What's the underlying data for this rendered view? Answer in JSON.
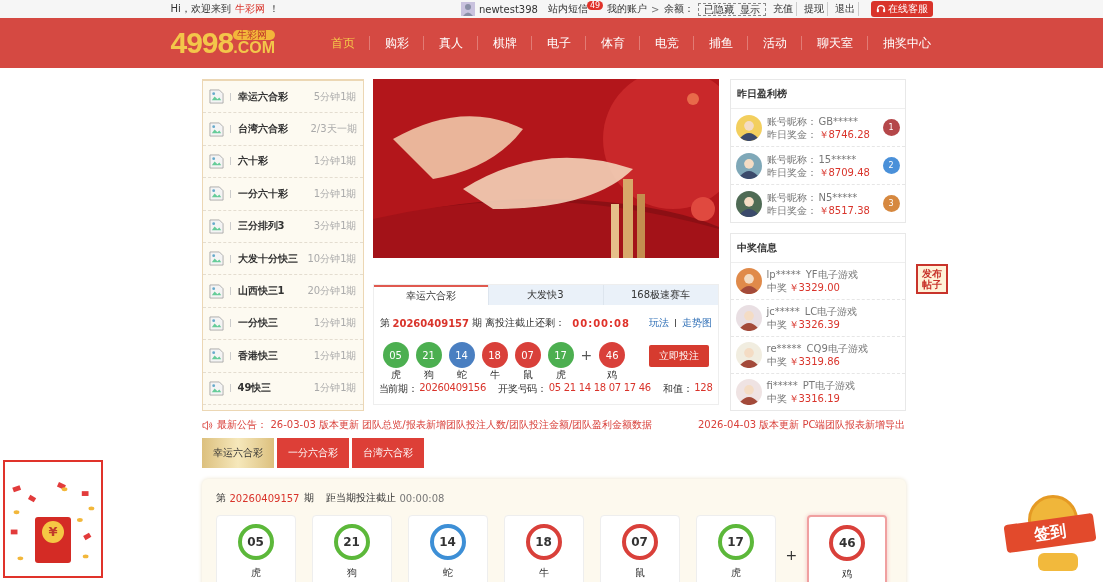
{
  "topbar": {
    "greeting": "Hi，欢迎来到",
    "site": "牛彩网",
    "exclaim": "！",
    "username": "newtest398",
    "messages": "站内短信",
    "message_count": "49",
    "account": "我的账户",
    "account_arrow": ">",
    "balance_label": "余额：",
    "balance_hidden": "已隐藏",
    "balance_show": "显示",
    "links": [
      "充值",
      "提现",
      "退出"
    ],
    "service": "在线客服"
  },
  "logo": {
    "number": "4998",
    "domain": ".COM",
    "badge": "牛彩网"
  },
  "nav": [
    {
      "label": "首页",
      "selected": true
    },
    {
      "label": "购彩",
      "selected": false
    },
    {
      "label": "真人",
      "selected": false
    },
    {
      "label": "棋牌",
      "selected": false
    },
    {
      "label": "电子",
      "selected": false
    },
    {
      "label": "体育",
      "selected": false
    },
    {
      "label": "电竞",
      "selected": false
    },
    {
      "label": "捕鱼",
      "selected": false
    },
    {
      "label": "活动",
      "selected": false
    },
    {
      "label": "聊天室",
      "selected": false
    },
    {
      "label": "抽奖中心",
      "selected": false
    }
  ],
  "lottery_list": [
    {
      "name": "幸运六合彩",
      "period": "5分钟1期"
    },
    {
      "name": "台湾六合彩",
      "period": "2/3天一期"
    },
    {
      "name": "六十彩",
      "period": "1分钟1期"
    },
    {
      "name": "一分六十彩",
      "period": "1分钟1期"
    },
    {
      "name": "三分排列3",
      "period": "3分钟1期"
    },
    {
      "name": "大发十分快三",
      "period": "10分钟1期"
    },
    {
      "name": "山西快三1",
      "period": "20分钟1期"
    },
    {
      "name": "一分快三",
      "period": "1分钟1期"
    },
    {
      "name": "香港快三",
      "period": "1分钟1期"
    },
    {
      "name": "49快三",
      "period": "1分钟1期"
    }
  ],
  "draw_panel": {
    "tabs": [
      {
        "label": "幸运六合彩",
        "selected": true
      },
      {
        "label": "大发快3",
        "selected": false
      },
      {
        "label": "168极速赛车",
        "selected": false
      }
    ],
    "issue_prefix": "第",
    "issue": "20260409157",
    "issue_suffix": "期 离投注截止还剩：",
    "countdown": "00:00:08",
    "links": [
      "玩法",
      "走势图"
    ],
    "balls": [
      {
        "number": "05",
        "zodiac": "虎",
        "color": "#4caf50"
      },
      {
        "number": "21",
        "zodiac": "狗",
        "color": "#4caf50"
      },
      {
        "number": "14",
        "zodiac": "蛇",
        "color": "#4a7fc1"
      },
      {
        "number": "18",
        "zodiac": "牛",
        "color": "#d9403a"
      },
      {
        "number": "07",
        "zodiac": "鼠",
        "color": "#d9403a"
      },
      {
        "number": "17",
        "zodiac": "虎",
        "color": "#4caf50"
      }
    ],
    "plus": "+",
    "special_ball": {
      "number": "46",
      "zodiac": "鸡",
      "color": "#d9403a"
    },
    "bet_button": "立即投注",
    "current_label": "当前期：",
    "current_issue": "20260409156",
    "result_label": "开奖号码：",
    "result": "05 21 14 18 07 17 46",
    "sum_label": "和值：",
    "sum": "128"
  },
  "ranking": {
    "title": "昨日盈利榜",
    "entries": [
      {
        "name_label": "账号昵称：",
        "name": "GB*****",
        "prize_label": "昨日奖金：",
        "prize": "￥8746.28",
        "rank": "1",
        "color": "#b5474a"
      },
      {
        "name_label": "账号昵称：",
        "name": "15*****",
        "prize_label": "昨日奖金：",
        "prize": "￥8709.48",
        "rank": "2",
        "color": "#4a90d9"
      },
      {
        "name_label": "账号昵称：",
        "name": "N5*****",
        "prize_label": "昨日奖金：",
        "prize": "￥8517.38",
        "rank": "3",
        "color": "#d6883f"
      }
    ]
  },
  "winners": {
    "title": "中奖信息",
    "entries": [
      {
        "user": "lp*****",
        "game": "YF电子游戏",
        "label": "中奖",
        "amount": "￥3329.00"
      },
      {
        "user": "jc*****",
        "game": "LC电子游戏",
        "label": "中奖",
        "amount": "￥3326.39"
      },
      {
        "user": "re*****",
        "game": "CQ9电子游戏",
        "label": "中奖",
        "amount": "￥3319.86"
      },
      {
        "user": "fi*****",
        "game": "PT电子游戏",
        "label": "中奖",
        "amount": "￥3316.19"
      }
    ]
  },
  "post_sticker": {
    "label": "发布帖子"
  },
  "notice": {
    "label": "最新公告：",
    "items": [
      "26-03-03 版本更新 团队总览/报表新增团队投注人数/团队投注金额/团队盈利金额数据",
      "2026-04-03 版本更新 PC端团队报表新增导出"
    ]
  },
  "game_tabs": [
    {
      "label": "幸运六合彩",
      "selected": true
    },
    {
      "label": "一分六合彩",
      "selected": false
    },
    {
      "label": "台湾六合彩",
      "selected": false
    }
  ],
  "main_draw": {
    "issue_prefix": "第",
    "issue": "20260409157",
    "issue_suffix": "期",
    "deadline_label": "距当期投注截止",
    "countdown": "00:00:08",
    "balls": [
      {
        "number": "05",
        "zodiac": "虎",
        "color": "#5cb83a"
      },
      {
        "number": "21",
        "zodiac": "狗",
        "color": "#5cb83a"
      },
      {
        "number": "14",
        "zodiac": "蛇",
        "color": "#3d8fd6"
      },
      {
        "number": "18",
        "zodiac": "牛",
        "color": "#d9403a"
      },
      {
        "number": "07",
        "zodiac": "鼠",
        "color": "#d9403a"
      },
      {
        "number": "17",
        "zodiac": "虎",
        "color": "#5cb83a"
      }
    ],
    "plus": "+",
    "special_ball": {
      "number": "46",
      "zodiac": "鸡",
      "color": "#d9403a"
    }
  },
  "envelope": {
    "symbol": "¥"
  },
  "checkin": {
    "label": "签到"
  }
}
